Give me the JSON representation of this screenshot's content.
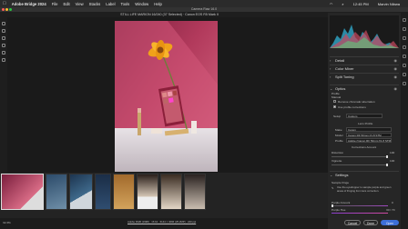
{
  "menubar": {
    "apple": "",
    "app_name": "Adobe Bridge 2024",
    "items": [
      "File",
      "Edit",
      "View",
      "Stacks",
      "Label",
      "Tools",
      "Window",
      "Help"
    ],
    "time": "12:45 PM",
    "user": "Marvin Nibwa"
  },
  "window": {
    "title": "Camera Raw 16.0"
  },
  "document": {
    "title": "STILL LIFE MARION 16/240 (37 Selected) · Canon EOS R5 Mark II"
  },
  "panel": {
    "sections": [
      {
        "label": "Detail"
      },
      {
        "label": "Color Mixer"
      },
      {
        "label": "Split Toning"
      },
      {
        "label": "Optics"
      }
    ],
    "optics": {
      "profile_label": "Profile",
      "manual_label": "Manual",
      "remove_ca": "Remove chromatic aberration",
      "use_profile": "Use profile corrections",
      "setup_label": "Setup",
      "setup_value": "Custom",
      "lens_profile_heading": "Lens Profile",
      "make_label": "Make",
      "make_value": "Canon",
      "model_label": "Model",
      "model_value": "Canon RF 50mm f/1.8 STM",
      "profile_row_label": "Profile",
      "profile_row_value": "Adobe (Canon RF 50mm f/1.8 STM)",
      "corrections_heading": "Corrections Amount",
      "distortion_label": "Distortion",
      "distortion_value": "100",
      "vignette_label": "Vignette",
      "vignette_value": "100"
    },
    "settings_label": "Settings",
    "defringe": {
      "heading": "Sample fringe",
      "desc": "Use the eyedropper to sample purple and green areas of fringing from lens correction.",
      "purple_amount_label": "Purple Amount",
      "purple_amount_value": "0",
      "purple_hue_label": "Purple Hue",
      "purple_hue_value": "30 / 70"
    }
  },
  "bottom": {
    "zoom": "32.3%",
    "file_info": "Adobe RGB (1998) · 16 bit · 6144 × 4096 (25.2MP) · 240 ppi",
    "cancel_label": "Cancel",
    "done_label": "Done",
    "open_label": "Open"
  },
  "filmstrip": {
    "thumb_count": 8
  }
}
